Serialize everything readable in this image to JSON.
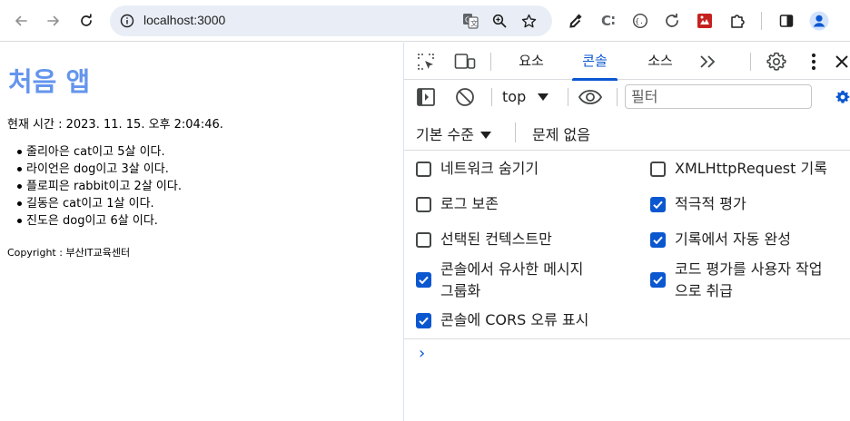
{
  "browser": {
    "url": "localhost:3000",
    "icons": [
      "back-icon",
      "forward-icon",
      "reload-icon",
      "info-icon",
      "translate-icon",
      "zoom-icon",
      "bookmark-star-icon",
      "eyedropper-icon",
      "extension-c-icon",
      "extension-code-icon",
      "extension-refresh-icon",
      "extension-red-icon",
      "puzzle-icon",
      "side-panel-icon",
      "profile-icon"
    ]
  },
  "page": {
    "title": "처음 앱",
    "time": "현재 시간 : 2023. 11. 15. 오후 2:04:46.",
    "items": [
      "줄리아은 cat이고 5살 이다.",
      "라이언은 dog이고 3살 이다.",
      "플로피은 rabbit이고 2살 이다.",
      "길동은 cat이고 1살 이다.",
      "진도은 dog이고 6살 이다."
    ],
    "copyright": "Copyright : 부산IT교육센터",
    "title_color": "#6495ed"
  },
  "devtools": {
    "tabs": [
      "요소",
      "콘솔",
      "소스"
    ],
    "active_tab": "콘솔",
    "more": "»",
    "context": "top",
    "filter_placeholder": "필터",
    "level": "기본 수준",
    "issues": "문제 없음",
    "options_left": [
      {
        "label": "네트워크 숨기기",
        "checked": false
      },
      {
        "label": "로그 보존",
        "checked": false
      },
      {
        "label": "선택된 컨텍스트만",
        "checked": false
      },
      {
        "label": "콘솔에서 유사한 메시지",
        "label2": "그룹화",
        "checked": true
      },
      {
        "label": "콘솔에 CORS 오류 표시",
        "checked": true
      }
    ],
    "options_right": [
      {
        "label": "XMLHttpRequest 기록",
        "checked": false
      },
      {
        "label": "적극적 평가",
        "checked": true
      },
      {
        "label": "기록에서 자동 완성",
        "checked": true
      },
      {
        "label": "코드 평가를 사용자 작업",
        "label2": "으로 취급",
        "checked": true
      }
    ],
    "prompt": "›",
    "accent_color": "#0b57d0"
  }
}
